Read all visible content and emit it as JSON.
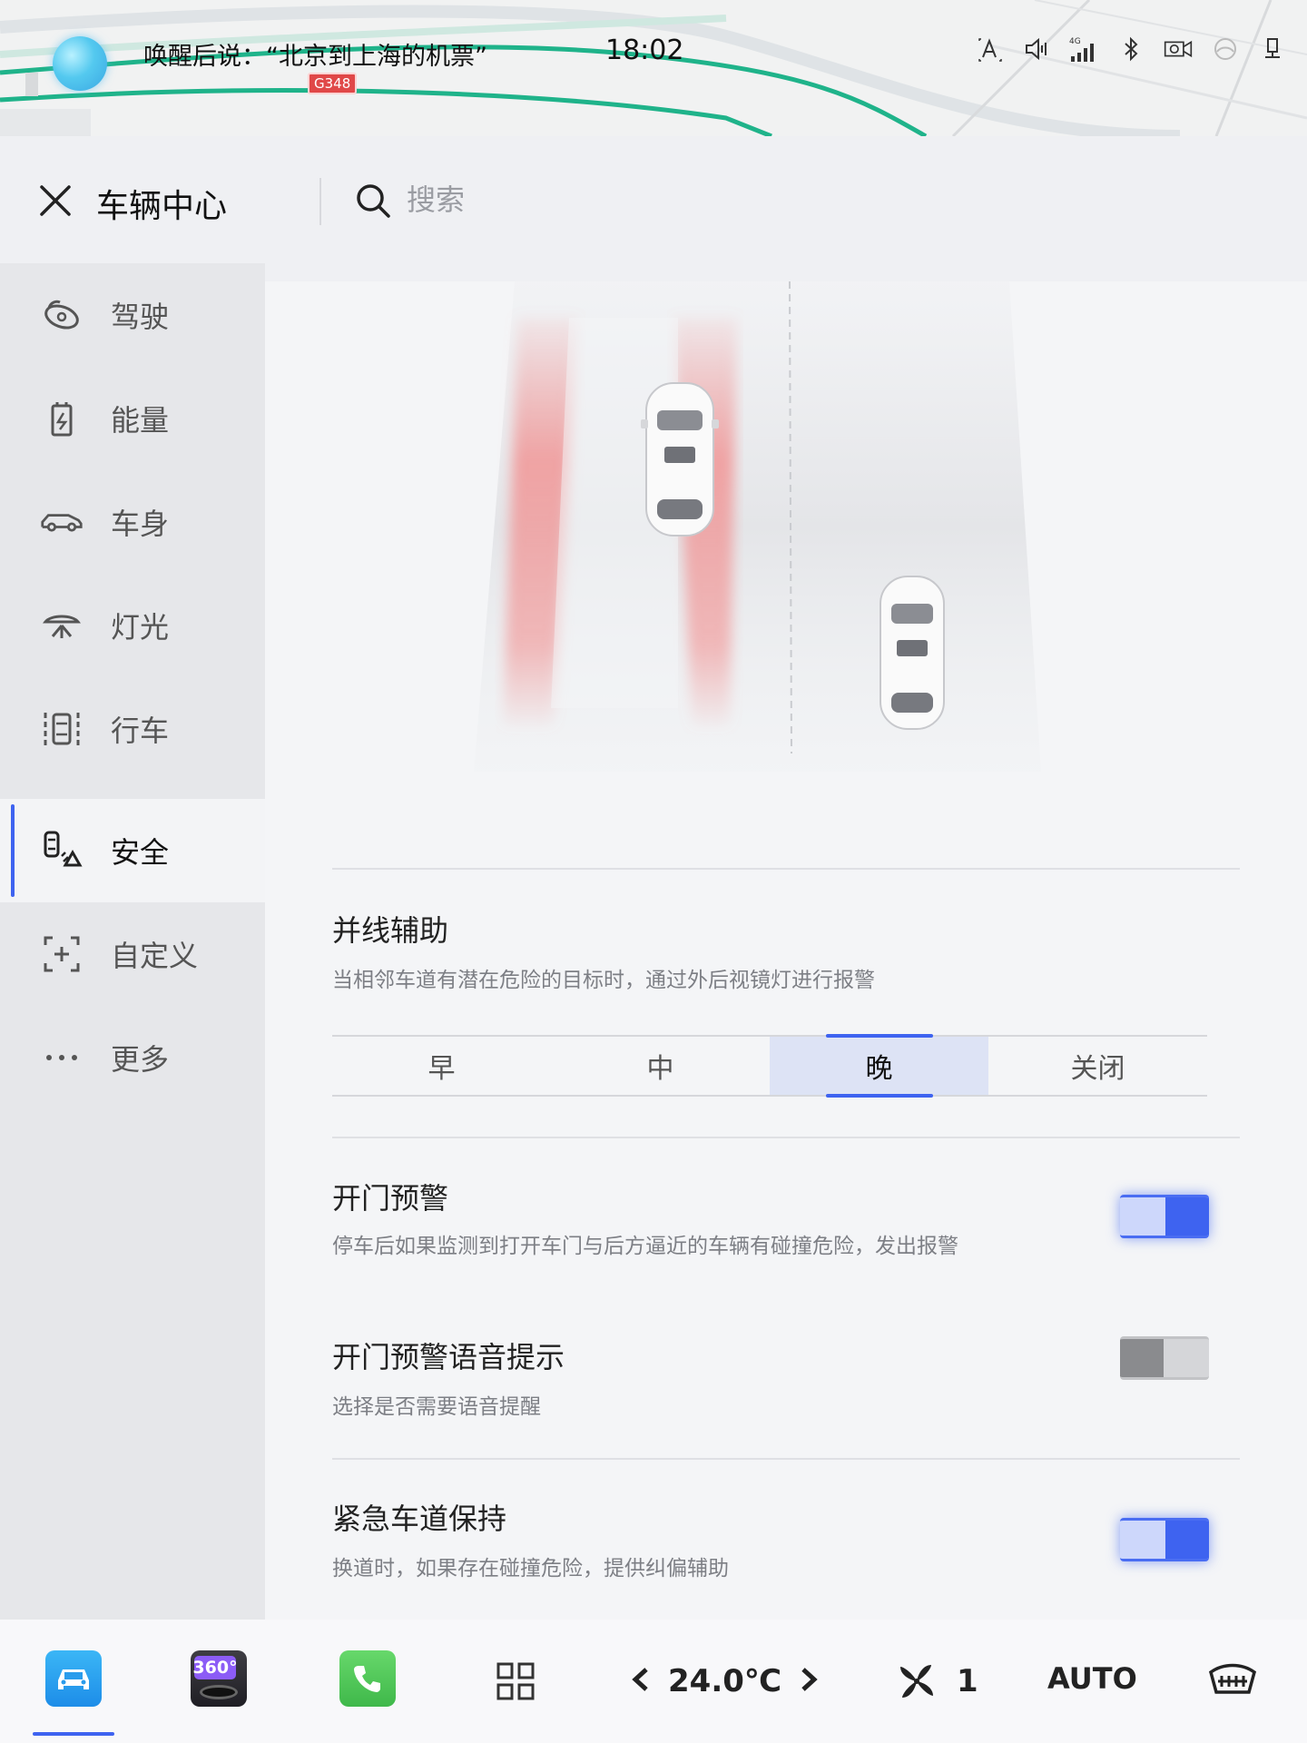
{
  "status_bar": {
    "wake_hint": "唤醒后说：“北京到上海的机票”",
    "road_badge": "G348",
    "time": "18:02",
    "icons": [
      "person-icon",
      "volume-icon",
      "signal-4g-icon",
      "bluetooth-icon",
      "camera-icon",
      "steering-assist-icon",
      "usb-icon"
    ]
  },
  "header": {
    "title": "车辆中心",
    "search_placeholder": "搜索"
  },
  "sidebar": {
    "items": [
      {
        "label": "驾驶",
        "icon": "steering-wheel-icon"
      },
      {
        "label": "能量",
        "icon": "battery-icon"
      },
      {
        "label": "车身",
        "icon": "car-body-icon"
      },
      {
        "label": "灯光",
        "icon": "headlight-icon"
      },
      {
        "label": "行车",
        "icon": "driving-icon"
      },
      {
        "label": "安全",
        "icon": "safety-icon",
        "active": true
      },
      {
        "label": "自定义",
        "icon": "custom-icon"
      },
      {
        "label": "更多",
        "icon": "more-icon"
      }
    ]
  },
  "settings": {
    "lane_assist": {
      "title": "并线辅助",
      "desc": "当相邻车道有潜在危险的目标时，通过外后视镜灯进行报警",
      "options": [
        "早",
        "中",
        "晚",
        "关闭"
      ],
      "selected": "晚"
    },
    "door_warning": {
      "title": "开门预警",
      "desc": "停车后如果监测到打开车门与后方逼近的车辆有碰撞危险，发出报警",
      "enabled": true
    },
    "door_warning_voice": {
      "title": "开门预警语音提示",
      "desc": "选择是否需要语音提醒",
      "enabled": false
    },
    "emergency_lane_keep": {
      "title": "紧急车道保持",
      "desc": "换道时，如果存在碰撞危险，提供纠偏辅助",
      "enabled": true
    }
  },
  "dock": {
    "temperature": "24.0℃",
    "fan_level": "1",
    "auto_label": "AUTO",
    "app_360_label": "360°"
  },
  "colors": {
    "accent": "#3e63f0",
    "danger_zone": "#f08c8c"
  }
}
